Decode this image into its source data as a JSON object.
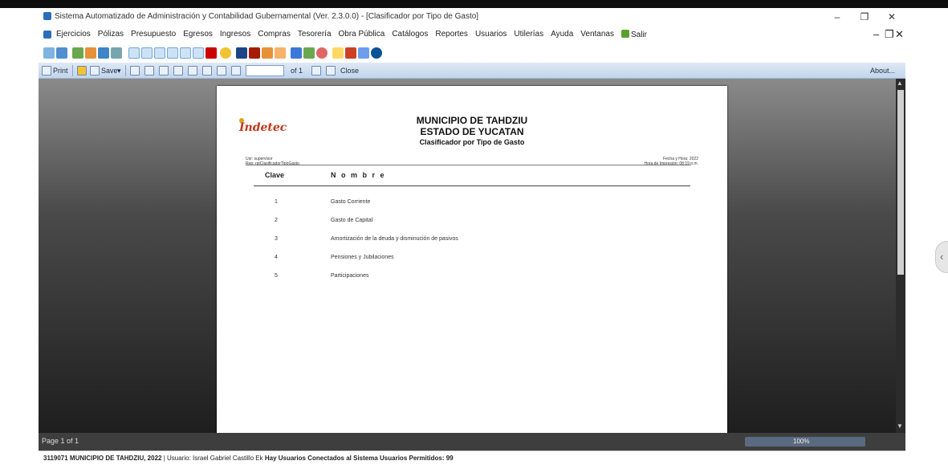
{
  "window": {
    "title": "Sistema Automatizado de Administración y Contabilidad Gubernamental (Ver. 2.3.0.0) - [Clasificador por Tipo de Gasto]"
  },
  "menu": {
    "items": [
      "Ejercicios",
      "Pólizas",
      "Presupuesto",
      "Egresos",
      "Ingresos",
      "Compras",
      "Tesorería",
      "Obra Pública",
      "Catálogos",
      "Reportes",
      "Usuarios",
      "Utilerías",
      "Ayuda",
      "Ventanas",
      "Salir"
    ]
  },
  "report_toolbar": {
    "print": "Print",
    "save": "Save",
    "page_input": "",
    "page_of": "of 1",
    "close": "Close",
    "about": "About..."
  },
  "report": {
    "logo": "Indetec",
    "municipality": "MUNICIPIO DE TAHDZIU",
    "state": "ESTADO DE YUCATAN",
    "subtitle": "Clasificador por Tipo de Gasto",
    "meta_left_1": "Usr: supervisor",
    "meta_left_2": "Rep: rptClasificadorTipoGasto",
    "meta_right_1": "Fecha y Hora: 2022",
    "meta_right_2": "Hora de Impresión: 08:19 p.m.",
    "col_clave": "Clave",
    "col_nombre": "N o m b r e",
    "rows": [
      {
        "clave": "1",
        "nombre": "Gasto Corriente"
      },
      {
        "clave": "2",
        "nombre": "Gasto de Capital"
      },
      {
        "clave": "3",
        "nombre": "Amortización de la deuda y disminución de pasivos"
      },
      {
        "clave": "4",
        "nombre": "Pensiones y Jubilaciones"
      },
      {
        "clave": "5",
        "nombre": "Participaciones"
      }
    ]
  },
  "status": {
    "page": "Page 1 of 1",
    "zoom": "100%"
  },
  "taskbar": {
    "entity": "3119071 MUNICIPIO DE TAHDZIU, 2022",
    "user": "| Usuario: Israel Gabriel Castillo Ek",
    "message": "Hay Usuarios Conectados al Sistema",
    "users_count": "Usuarios Permitidos: 99"
  },
  "colors": {
    "accent": "#2a6ebb",
    "logo": "#c0391b"
  }
}
